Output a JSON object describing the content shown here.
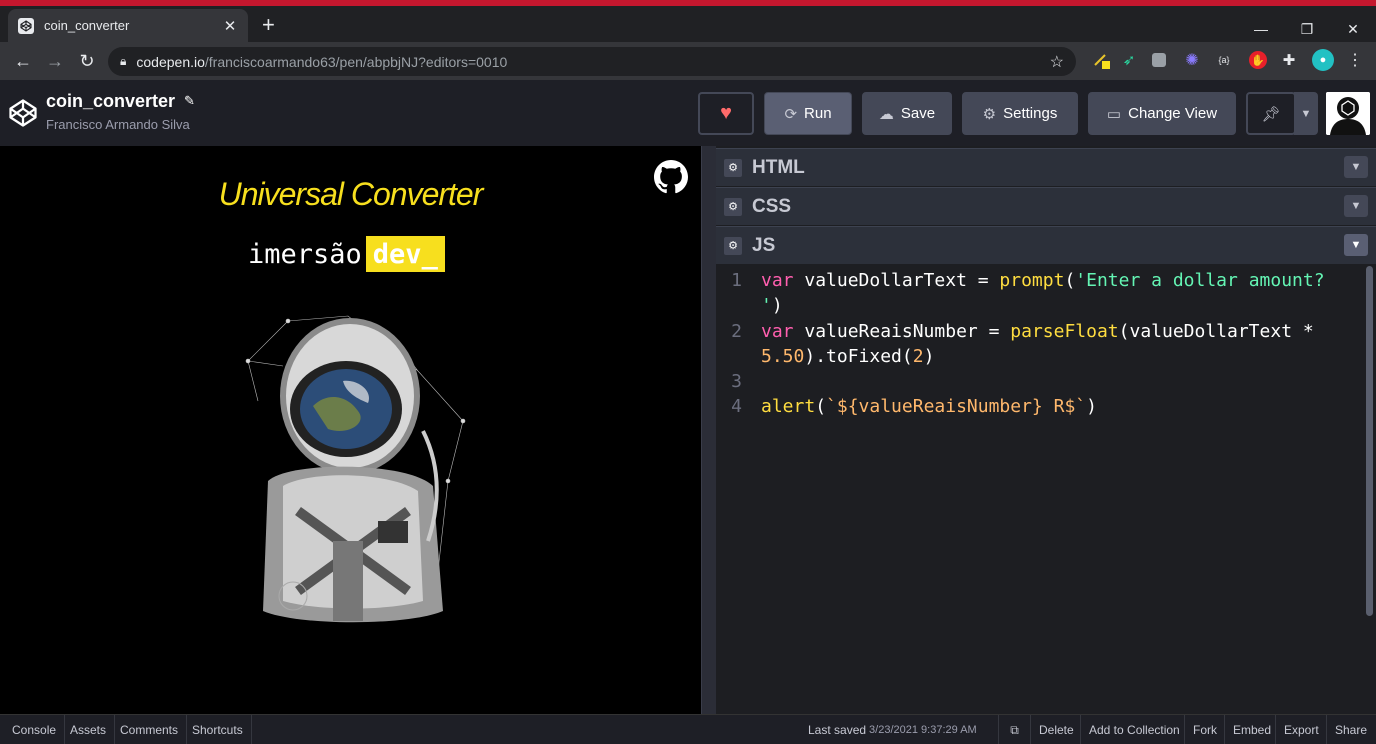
{
  "browser": {
    "tab_title": "coin_converter",
    "tab_close": "✕",
    "new_tab": "+",
    "url_domain": "codepen.io",
    "url_path": "/franciscoarmando63/pen/abpbjNJ?editors=0010",
    "window_controls": [
      "—",
      "❐",
      "✕"
    ]
  },
  "header": {
    "pen_title": "coin_converter",
    "author": "Francisco Armando Silva",
    "run_label": "Run",
    "save_label": "Save",
    "settings_label": "Settings",
    "change_view_label": "Change View"
  },
  "preview": {
    "title": "Universal Converter",
    "imersao": "imersão",
    "dev": "dev_"
  },
  "editors": {
    "html_label": "HTML",
    "css_label": "CSS",
    "js_label": "JS"
  },
  "code": {
    "line_numbers": [
      "1",
      "2",
      "3",
      "4"
    ],
    "tokens": {
      "l1_kw": "var",
      "l1_var": " valueDollarText = ",
      "l1_fn": "prompt",
      "l1_p1": "(",
      "l1_str": "'Enter a dollar amount?",
      "l1b_str": "'",
      "l1b_p": ")",
      "l2_kw": "var",
      "l2_var": " valueReaisNumber = ",
      "l2_fn": "parseFloat",
      "l2_p1": "(valueDollarText * ",
      "l2b_num": "5.50",
      "l2b_p": ").toFixed(",
      "l2b_num2": "2",
      "l2b_p2": ")",
      "l4_fn": "alert",
      "l4_p1": "(",
      "l4_tpl": "`${valueReaisNumber} R$`",
      "l4_p2": ")"
    }
  },
  "footer": {
    "console": "Console",
    "assets": "Assets",
    "comments": "Comments",
    "shortcuts": "Shortcuts",
    "last_saved_label": "Last saved",
    "last_saved_time": "3/23/2021 9:37:29 AM",
    "delete": "Delete",
    "add_to_collection": "Add to Collection",
    "fork": "Fork",
    "embed": "Embed",
    "export": "Export",
    "share": "Share"
  },
  "colors": {
    "accent_yellow": "#f7df1e",
    "keyword": "#ff5faf",
    "function": "#ffdd40",
    "string": "#64f5b4",
    "number": "#ffb86c",
    "header_bg": "#1e1f26"
  },
  "icons": [
    "codepen-logo-icon",
    "lock-icon",
    "star-icon",
    "heart-icon",
    "refresh-icon",
    "cloud-icon",
    "gear-icon",
    "change-view-icon",
    "pin-icon",
    "chevron-down-icon",
    "github-icon",
    "external-link-icon",
    "pencil-icon"
  ]
}
